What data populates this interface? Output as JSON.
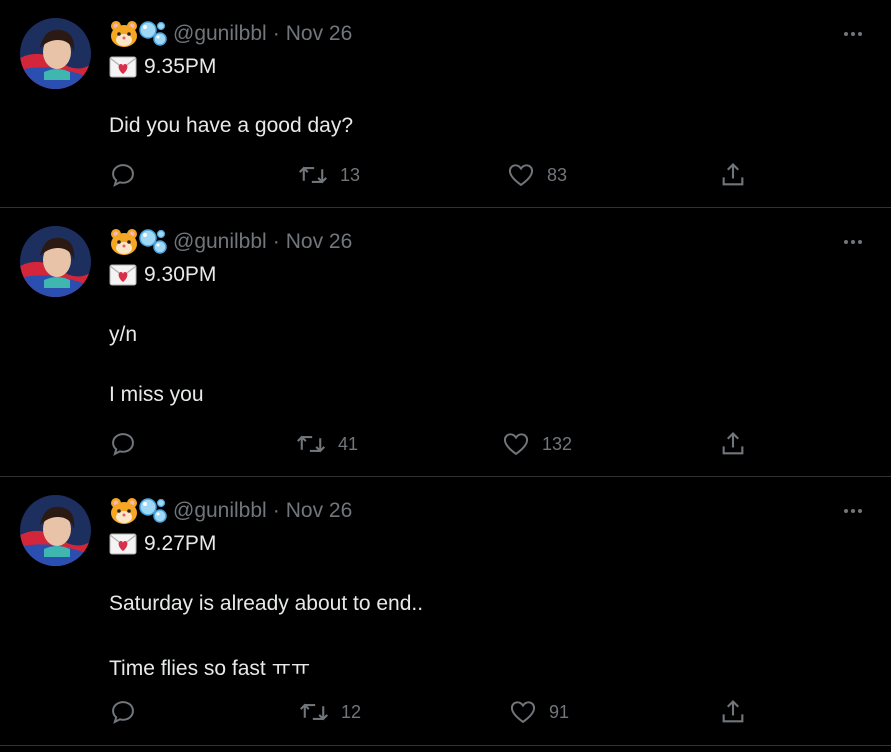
{
  "tweets": [
    {
      "handle": "@gunilbbl",
      "separator": "·",
      "date": "Nov 26",
      "time": "9.35PM",
      "lines": [
        "Did you have a good day?"
      ],
      "replies": "",
      "retweets": "13",
      "likes": "83"
    },
    {
      "handle": "@gunilbbl",
      "separator": "·",
      "date": "Nov 26",
      "time": "9.30PM",
      "lines": [
        "y/n",
        "I miss you"
      ],
      "replies": "",
      "retweets": "41",
      "likes": "132"
    },
    {
      "handle": "@gunilbbl",
      "separator": "·",
      "date": "Nov 26",
      "time": "9.27PM",
      "lines": [
        "Saturday is already about to end..",
        "Time flies so fast ㅠㅠ"
      ],
      "replies": "",
      "retweets": "12",
      "likes": "91"
    }
  ],
  "icons": {
    "name_emojis": [
      "hamster-emoji-icon",
      "bubbles-emoji-icon"
    ],
    "time_emoji": "love-letter-emoji-icon",
    "more": "more-options-icon",
    "reply": "reply-icon",
    "retweet": "retweet-icon",
    "like": "like-icon",
    "share": "share-icon"
  },
  "colors": {
    "background": "#000000",
    "text_primary": "#e7e9ea",
    "text_secondary": "#71767b",
    "divider": "#2f3336"
  }
}
